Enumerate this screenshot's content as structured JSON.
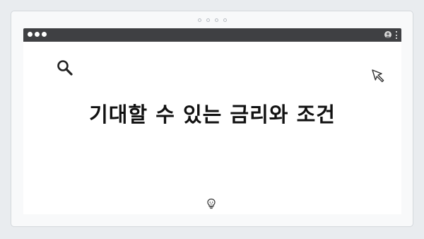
{
  "page": {
    "headline": "기대할 수 있는 금리와 조건"
  },
  "icons": {
    "search": "search-icon",
    "cursor": "cursor-icon",
    "bulb": "lightbulb-icon",
    "profile": "profile-icon",
    "menu": "menu-icon"
  },
  "colors": {
    "background": "#e9ecef",
    "browser_bar": "#3f4043",
    "content": "#ffffff",
    "text": "#111111"
  }
}
